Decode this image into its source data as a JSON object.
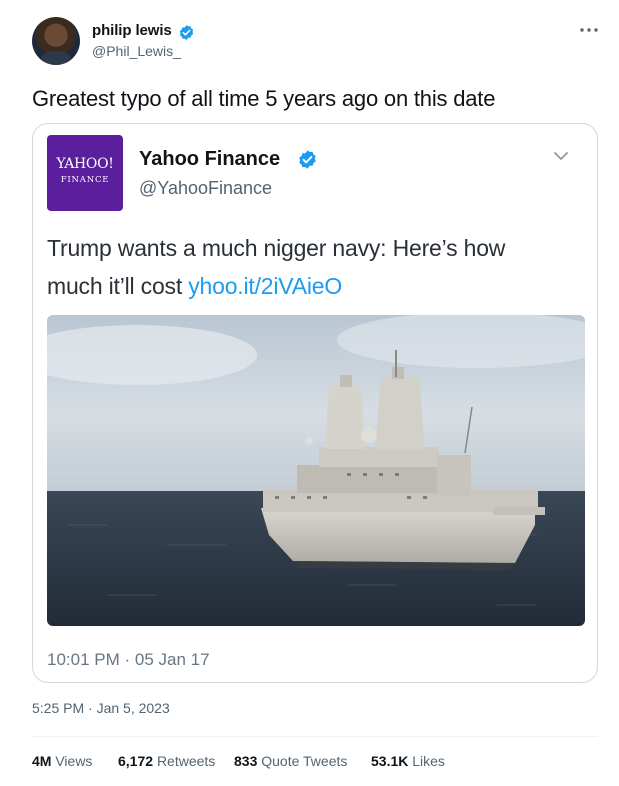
{
  "author": {
    "name": "philip lewis",
    "handle": "@Phil_Lewis_"
  },
  "tweet": {
    "text": "Greatest typo of all time 5 years ago on this date",
    "timestamp": "5:25 PM · Jan 5, 2023"
  },
  "quoted": {
    "logo_line1": "YAHOO!",
    "logo_line2": "FINANCE",
    "name": "Yahoo Finance",
    "handle": "@YahooFinance",
    "text_line1": "Trump wants a much nigger navy: Here’s how",
    "text_line2": "much it’ll cost ",
    "link": "yhoo.it/2iVAieO",
    "time": "10:01 PM · 05 Jan 17"
  },
  "stats": [
    {
      "count": "4M",
      "label": "Views"
    },
    {
      "count": "6,172",
      "label": "Retweets"
    },
    {
      "count": "833",
      "label": "Quote Tweets"
    },
    {
      "count": "53.1K",
      "label": "Likes"
    }
  ],
  "colors": {
    "accent": "#1d9bf0",
    "yahoo_purple": "#5b1f9e",
    "secondary_text": "#536471"
  },
  "icons": [
    "verified-badge-icon",
    "more-icon",
    "chevron-down-icon"
  ]
}
